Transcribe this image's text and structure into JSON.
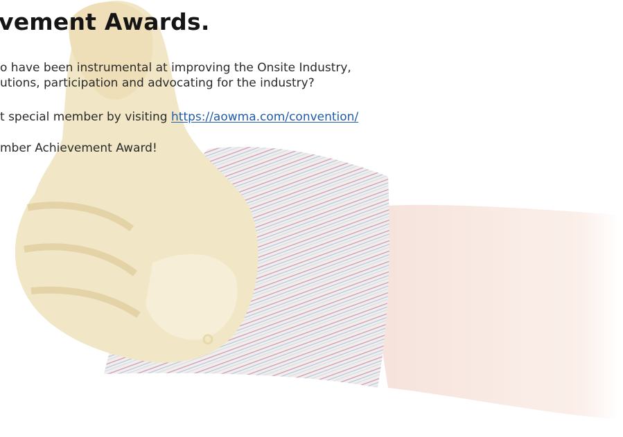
{
  "heading": "vement Awards.",
  "paragraph1": {
    "line1": "o have been instrumental at improving the Onsite Industry,",
    "line2": "utions, participation and advocating for the industry?"
  },
  "paragraph2": {
    "prefix": "t special member by visiting ",
    "link_text": "https://aowma.com/convention/"
  },
  "paragraph3": "mber Achievement Award!",
  "background": {
    "image": "thumbs-up-glove-illustration",
    "glove_color": "#f1e6c6",
    "cuff_color": "#eeeeee",
    "cuff_stripe_color": "#d7a0b4",
    "arm_color": "#f8ebe6"
  },
  "colors": {
    "link": "#1f5ba8",
    "text": "#2a2a2a",
    "heading": "#151515"
  }
}
